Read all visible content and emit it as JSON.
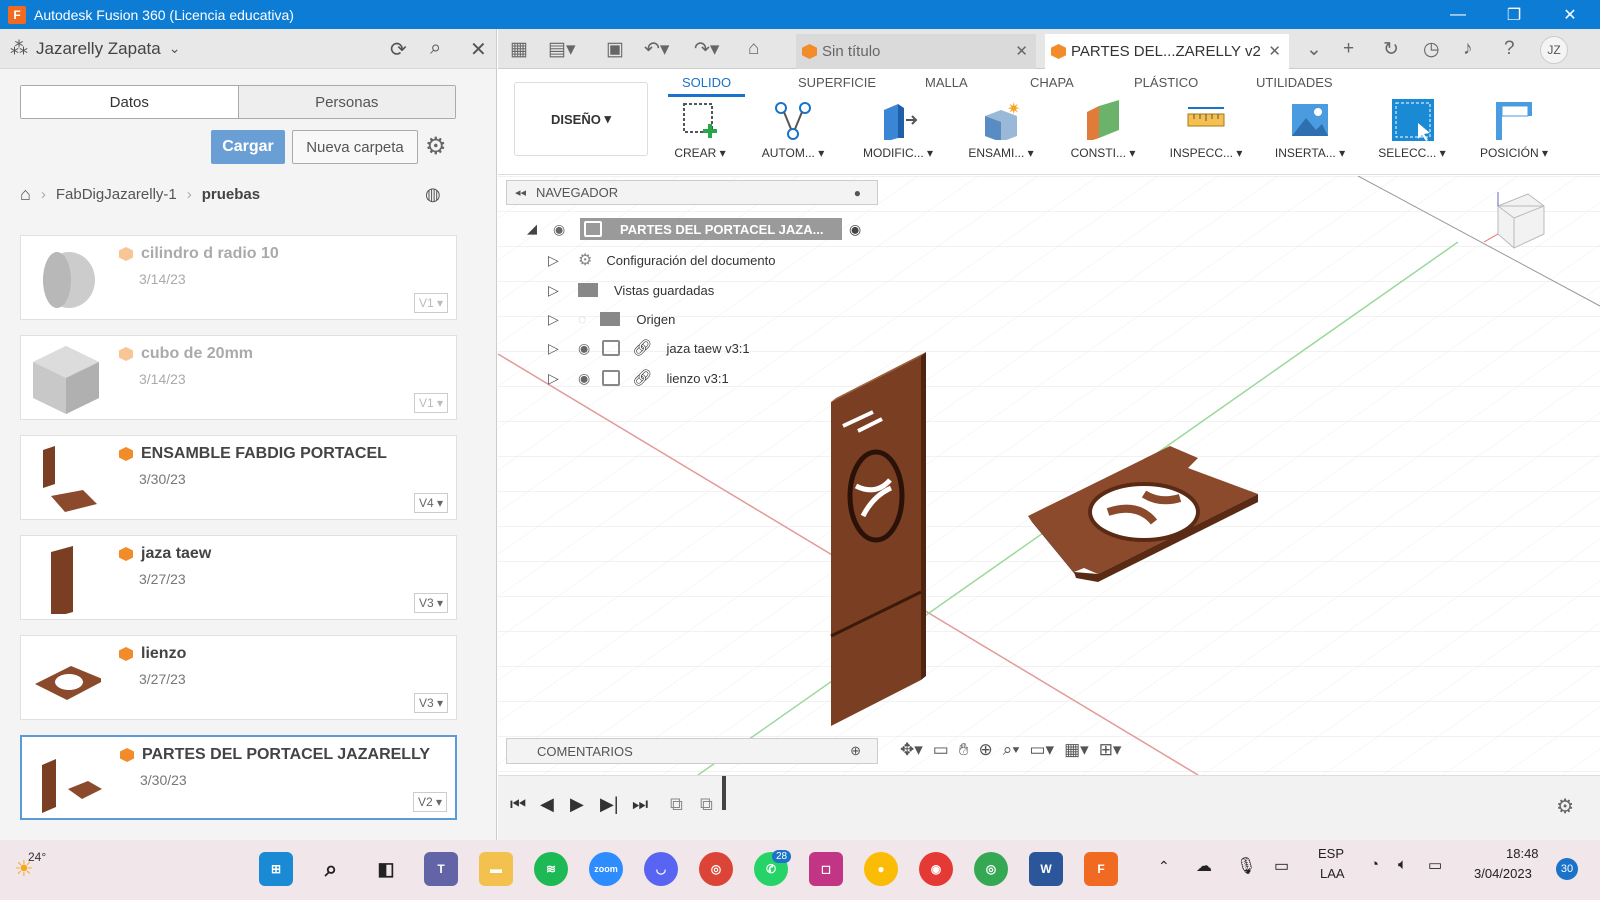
{
  "window": {
    "title": "Autodesk Fusion 360 (Licencia educativa)",
    "logo": "F"
  },
  "data_panel": {
    "user": "Jazarelly Zapata",
    "tabs": [
      "Datos",
      "Personas"
    ],
    "upload_label": "Cargar",
    "new_folder_label": "Nueva carpeta",
    "breadcrumb": [
      "FabDigJazarelly-1",
      "pruebas"
    ],
    "files": [
      {
        "name": "cilindro d radio 10",
        "date": "3/14/23",
        "version": "V1"
      },
      {
        "name": "cubo de 20mm",
        "date": "3/14/23",
        "version": "V1"
      },
      {
        "name": "ENSAMBLE FABDIG PORTACEL",
        "date": "3/30/23",
        "version": "V4"
      },
      {
        "name": "jaza taew",
        "date": "3/27/23",
        "version": "V3"
      },
      {
        "name": "lienzo",
        "date": "3/27/23",
        "version": "V3"
      },
      {
        "name": "PARTES DEL PORTACEL JAZARELLY",
        "date": "3/30/23",
        "version": "V2"
      }
    ]
  },
  "doc_tabs": [
    {
      "label": "Sin título"
    },
    {
      "label": "PARTES DEL...ZARELLY v2"
    }
  ],
  "user_initials": "JZ",
  "ribbon": {
    "workspace": "DISEÑO",
    "tabs": [
      "SOLIDO",
      "SUPERFICIE",
      "MALLA",
      "CHAPA",
      "PLÁSTICO",
      "UTILIDADES"
    ],
    "groups": [
      "CREAR",
      "AUTOM...",
      "MODIFIC...",
      "ENSAMI...",
      "CONSTI...",
      "INSPECC...",
      "INSERTA...",
      "SELECC...",
      "POSICIÓN"
    ]
  },
  "browser": {
    "title": "NAVEGADOR",
    "root": "PARTES DEL PORTACEL JAZA...",
    "items": [
      "Configuración del documento",
      "Vistas guardadas",
      "Origen",
      "jaza taew v3:1",
      "lienzo v3:1"
    ]
  },
  "comments_label": "COMENTARIOS",
  "taskbar": {
    "weather_temp": "24°",
    "whatsapp_badge": "28",
    "language": "ESP",
    "layout": "LAA",
    "time": "18:48",
    "date": "3/04/2023",
    "notif_count": "30"
  },
  "colors": {
    "titlebar": "#0c7cd5",
    "accent": "#1a73c8",
    "wood": "#8b4a2b",
    "orange": "#f28c2a"
  }
}
